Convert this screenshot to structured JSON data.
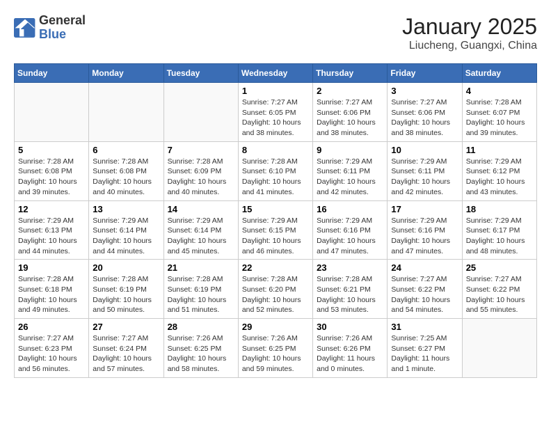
{
  "header": {
    "logo_line1": "General",
    "logo_line2": "Blue",
    "title": "January 2025",
    "subtitle": "Liucheng, Guangxi, China"
  },
  "weekdays": [
    "Sunday",
    "Monday",
    "Tuesday",
    "Wednesday",
    "Thursday",
    "Friday",
    "Saturday"
  ],
  "weeks": [
    [
      {
        "day": "",
        "info": ""
      },
      {
        "day": "",
        "info": ""
      },
      {
        "day": "",
        "info": ""
      },
      {
        "day": "1",
        "info": "Sunrise: 7:27 AM\nSunset: 6:05 PM\nDaylight: 10 hours\nand 38 minutes."
      },
      {
        "day": "2",
        "info": "Sunrise: 7:27 AM\nSunset: 6:06 PM\nDaylight: 10 hours\nand 38 minutes."
      },
      {
        "day": "3",
        "info": "Sunrise: 7:27 AM\nSunset: 6:06 PM\nDaylight: 10 hours\nand 38 minutes."
      },
      {
        "day": "4",
        "info": "Sunrise: 7:28 AM\nSunset: 6:07 PM\nDaylight: 10 hours\nand 39 minutes."
      }
    ],
    [
      {
        "day": "5",
        "info": "Sunrise: 7:28 AM\nSunset: 6:08 PM\nDaylight: 10 hours\nand 39 minutes."
      },
      {
        "day": "6",
        "info": "Sunrise: 7:28 AM\nSunset: 6:08 PM\nDaylight: 10 hours\nand 40 minutes."
      },
      {
        "day": "7",
        "info": "Sunrise: 7:28 AM\nSunset: 6:09 PM\nDaylight: 10 hours\nand 40 minutes."
      },
      {
        "day": "8",
        "info": "Sunrise: 7:28 AM\nSunset: 6:10 PM\nDaylight: 10 hours\nand 41 minutes."
      },
      {
        "day": "9",
        "info": "Sunrise: 7:29 AM\nSunset: 6:11 PM\nDaylight: 10 hours\nand 42 minutes."
      },
      {
        "day": "10",
        "info": "Sunrise: 7:29 AM\nSunset: 6:11 PM\nDaylight: 10 hours\nand 42 minutes."
      },
      {
        "day": "11",
        "info": "Sunrise: 7:29 AM\nSunset: 6:12 PM\nDaylight: 10 hours\nand 43 minutes."
      }
    ],
    [
      {
        "day": "12",
        "info": "Sunrise: 7:29 AM\nSunset: 6:13 PM\nDaylight: 10 hours\nand 44 minutes."
      },
      {
        "day": "13",
        "info": "Sunrise: 7:29 AM\nSunset: 6:14 PM\nDaylight: 10 hours\nand 44 minutes."
      },
      {
        "day": "14",
        "info": "Sunrise: 7:29 AM\nSunset: 6:14 PM\nDaylight: 10 hours\nand 45 minutes."
      },
      {
        "day": "15",
        "info": "Sunrise: 7:29 AM\nSunset: 6:15 PM\nDaylight: 10 hours\nand 46 minutes."
      },
      {
        "day": "16",
        "info": "Sunrise: 7:29 AM\nSunset: 6:16 PM\nDaylight: 10 hours\nand 47 minutes."
      },
      {
        "day": "17",
        "info": "Sunrise: 7:29 AM\nSunset: 6:16 PM\nDaylight: 10 hours\nand 47 minutes."
      },
      {
        "day": "18",
        "info": "Sunrise: 7:29 AM\nSunset: 6:17 PM\nDaylight: 10 hours\nand 48 minutes."
      }
    ],
    [
      {
        "day": "19",
        "info": "Sunrise: 7:28 AM\nSunset: 6:18 PM\nDaylight: 10 hours\nand 49 minutes."
      },
      {
        "day": "20",
        "info": "Sunrise: 7:28 AM\nSunset: 6:19 PM\nDaylight: 10 hours\nand 50 minutes."
      },
      {
        "day": "21",
        "info": "Sunrise: 7:28 AM\nSunset: 6:19 PM\nDaylight: 10 hours\nand 51 minutes."
      },
      {
        "day": "22",
        "info": "Sunrise: 7:28 AM\nSunset: 6:20 PM\nDaylight: 10 hours\nand 52 minutes."
      },
      {
        "day": "23",
        "info": "Sunrise: 7:28 AM\nSunset: 6:21 PM\nDaylight: 10 hours\nand 53 minutes."
      },
      {
        "day": "24",
        "info": "Sunrise: 7:27 AM\nSunset: 6:22 PM\nDaylight: 10 hours\nand 54 minutes."
      },
      {
        "day": "25",
        "info": "Sunrise: 7:27 AM\nSunset: 6:22 PM\nDaylight: 10 hours\nand 55 minutes."
      }
    ],
    [
      {
        "day": "26",
        "info": "Sunrise: 7:27 AM\nSunset: 6:23 PM\nDaylight: 10 hours\nand 56 minutes."
      },
      {
        "day": "27",
        "info": "Sunrise: 7:27 AM\nSunset: 6:24 PM\nDaylight: 10 hours\nand 57 minutes."
      },
      {
        "day": "28",
        "info": "Sunrise: 7:26 AM\nSunset: 6:25 PM\nDaylight: 10 hours\nand 58 minutes."
      },
      {
        "day": "29",
        "info": "Sunrise: 7:26 AM\nSunset: 6:25 PM\nDaylight: 10 hours\nand 59 minutes."
      },
      {
        "day": "30",
        "info": "Sunrise: 7:26 AM\nSunset: 6:26 PM\nDaylight: 11 hours\nand 0 minutes."
      },
      {
        "day": "31",
        "info": "Sunrise: 7:25 AM\nSunset: 6:27 PM\nDaylight: 11 hours\nand 1 minute."
      },
      {
        "day": "",
        "info": ""
      }
    ]
  ]
}
